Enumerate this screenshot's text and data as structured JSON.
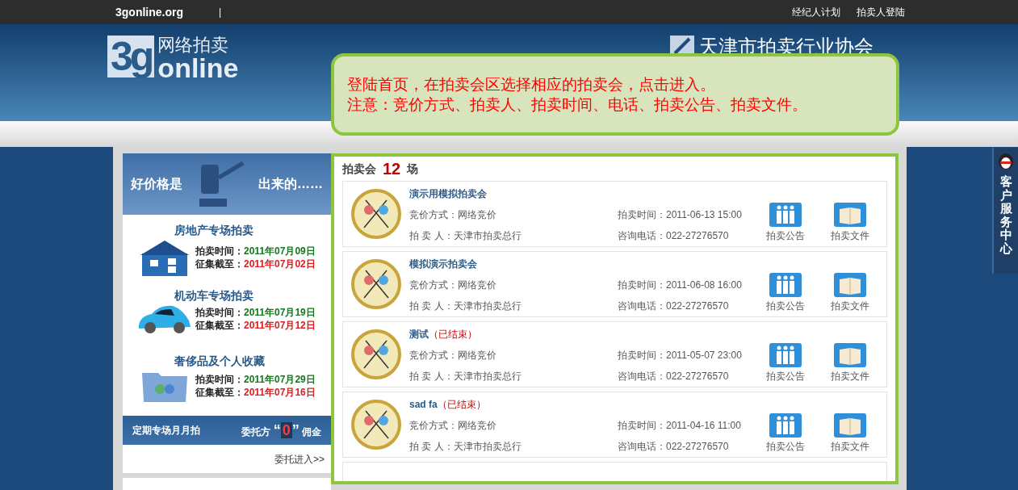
{
  "top_bar": {
    "site": "3gonline.org",
    "separator": "|",
    "links": [
      "经纪人计划",
      "拍卖人登陆"
    ]
  },
  "header": {
    "logo_3g": "3g",
    "logo_cn": "网络拍卖",
    "logo_online": "online",
    "association": "天津市拍卖行业协会"
  },
  "callout": {
    "lines": [
      "登陆首页，在拍卖会区选择相应的拍卖会，点击进入。",
      "注意：竞价方式、拍卖人、拍卖时间、电话、拍卖公告、拍卖文件。"
    ]
  },
  "promo": {
    "banner_left": "好价格是",
    "banner_right": "出来的……",
    "categories": [
      {
        "kind": "house",
        "title": "房地产专场拍卖",
        "time_label": "拍卖时间：",
        "time": "2011年07月09日",
        "deadline_label": "征集截至：",
        "deadline": "2011年07月02日"
      },
      {
        "kind": "car",
        "title": "机动车专场拍卖",
        "time_label": "拍卖时间：",
        "time": "2011年07月19日",
        "deadline_label": "征集截至：",
        "deadline": "2011年07月12日"
      },
      {
        "kind": "folder",
        "title": "奢侈品及个人收藏",
        "time_label": "拍卖时间：",
        "time": "2011年07月29日",
        "deadline_label": "征集截至：",
        "deadline": "2011年07月16日"
      }
    ],
    "bar_left": "定期专场月月拍",
    "bar_entrust": "委托方",
    "bar_open_quote": "“",
    "bar_zero": "0",
    "bar_close_quote": "”",
    "bar_commission": "佣金",
    "link": "委托进入>>"
  },
  "auctions": {
    "label": "拍卖会",
    "count": "12",
    "unit": "场",
    "items": [
      {
        "title": "演示用模拟拍卖会",
        "method_label": "竞价方式：",
        "method": "网络竞价",
        "auctioneer_label": "拍 卖 人：",
        "auctioneer": "天津市拍卖总行",
        "time_label": "拍卖时间：",
        "time": "2011-06-13 15:00",
        "phone_label": "咨询电话：",
        "phone": "022-27276570",
        "notice": "拍卖公告",
        "docs": "拍卖文件"
      },
      {
        "title": "模拟演示拍卖会",
        "method_label": "竞价方式：",
        "method": "网络竞价",
        "auctioneer_label": "拍 卖 人：",
        "auctioneer": "天津市拍卖总行",
        "time_label": "拍卖时间：",
        "time": "2011-06-08 16:00",
        "phone_label": "咨询电话：",
        "phone": "022-27276570",
        "notice": "拍卖公告",
        "docs": "拍卖文件"
      },
      {
        "title": "测试",
        "status": "（已结束）",
        "method_label": "竞价方式：",
        "method": "网络竞价",
        "auctioneer_label": "拍 卖 人：",
        "auctioneer": "天津市拍卖总行",
        "time_label": "拍卖时间：",
        "time": "2011-05-07 23:00",
        "phone_label": "咨询电话：",
        "phone": "022-27276570",
        "notice": "拍卖公告",
        "docs": "拍卖文件"
      },
      {
        "title": "sad fa",
        "status": "（已结束）",
        "method_label": "竞价方式：",
        "method": "网络竞价",
        "auctioneer_label": "拍 卖 人：",
        "auctioneer": "天津市拍卖总行",
        "time_label": "拍卖时间：",
        "time": "2011-04-16 11:00",
        "phone_label": "咨询电话：",
        "phone": "022-27276570",
        "notice": "拍卖公告",
        "docs": "拍卖文件"
      }
    ]
  },
  "service": {
    "label": "客户服务中心"
  }
}
